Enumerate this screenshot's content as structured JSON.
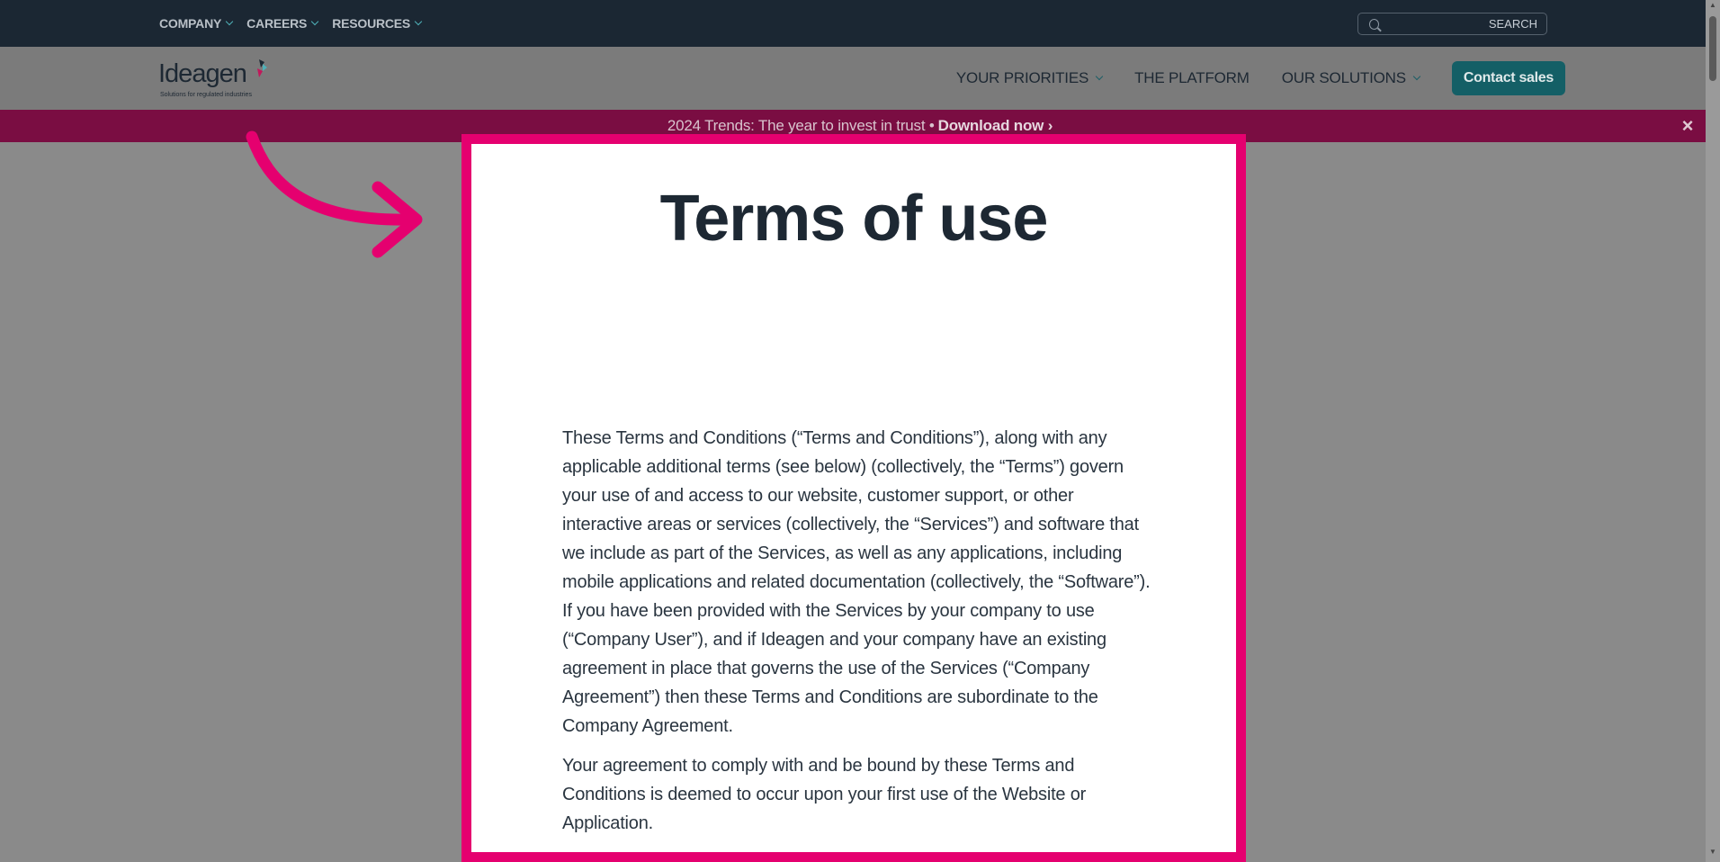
{
  "topbar": {
    "nav": [
      {
        "label": "COMPANY"
      },
      {
        "label": "CAREERS"
      },
      {
        "label": "RESOURCES"
      }
    ],
    "search": {
      "placeholder": "SEARCH"
    }
  },
  "header": {
    "logo": {
      "name": "Ideagen",
      "tagline": "Solutions for regulated industries"
    },
    "menu": [
      {
        "label": "YOUR PRIORITIES"
      },
      {
        "label": "THE PLATFORM"
      },
      {
        "label": "OUR SOLUTIONS"
      }
    ],
    "contact_label": "Contact sales"
  },
  "banner": {
    "text": "2024 Trends: The year to invest in trust •",
    "cta": "Download now ›",
    "close": "×"
  },
  "modal": {
    "title": "Terms of use",
    "paragraphs": [
      "These Terms and Conditions (“Terms and Conditions”), along with any applicable additional terms (see below) (collectively, the “Terms”) govern your use of and access to our website, customer support, or other interactive areas or services (collectively, the “Services”) and software that we include as part of the Services, as well as any applications, including mobile applications and related documentation (collectively, the “Software”). If you have been provided with the Services by your company to use (“Company User”), and if Ideagen and your company have an existing agreement in place that governs the use of the Services (“Company Agreement”) then these Terms and Conditions are subordinate to the Company Agreement.",
      "Your agreement to comply with and be bound by these Terms and Conditions is deemed to occur upon your first use of the Website or Application."
    ]
  },
  "colors": {
    "topbar_bg": "#1b2733",
    "accent_pink": "#e5006f",
    "teal_button": "#145f66",
    "text_dark": "#1d2833"
  },
  "icons": {
    "search": "search-icon",
    "chevron": "chevron-down-icon",
    "close": "close-icon",
    "arrow": "curved-arrow-icon"
  }
}
